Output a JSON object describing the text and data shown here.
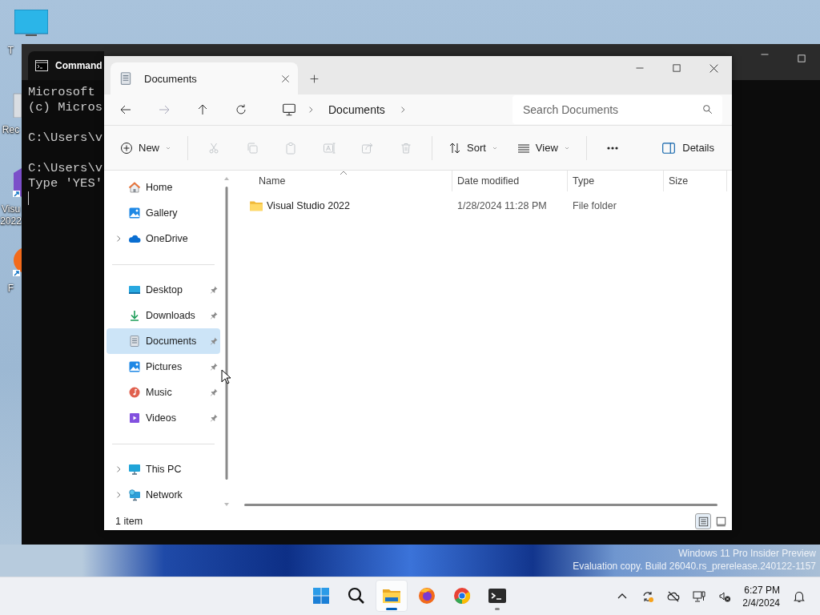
{
  "desktop": {
    "icons": [
      {
        "label_lines": [
          "T"
        ]
      },
      {
        "label_lines": [
          "Rec"
        ]
      },
      {
        "label_lines": [
          "Visu",
          "2022"
        ]
      },
      {
        "label_lines": [
          "F"
        ]
      }
    ],
    "watermark": [
      "Windows 11 Pro Insider Preview",
      "Evaluation copy. Build 26040.rs_prerelease.240122-1157"
    ]
  },
  "command_window": {
    "title": "Command",
    "blocks": [
      [
        "Microsoft",
        "(c) Micros"
      ],
      [
        "C:\\Users\\v"
      ],
      [
        "C:\\Users\\v",
        "Type 'YES'"
      ]
    ]
  },
  "explorer": {
    "tabs": [
      {
        "label": "Documents",
        "selected": true
      }
    ],
    "address": {
      "crumbs": [
        "Documents"
      ]
    },
    "search": {
      "placeholder": "Search Documents"
    },
    "commands": [
      {
        "kind": "menu",
        "label": "New",
        "disabled": false
      },
      {
        "kind": "separator"
      },
      {
        "kind": "icon",
        "disabled": true
      },
      {
        "kind": "icon",
        "disabled": true
      },
      {
        "kind": "icon",
        "disabled": true
      },
      {
        "kind": "icon",
        "disabled": true
      },
      {
        "kind": "icon",
        "disabled": true
      },
      {
        "kind": "icon",
        "disabled": true
      },
      {
        "kind": "separator"
      },
      {
        "kind": "menu",
        "label": "Sort",
        "disabled": false
      },
      {
        "kind": "menu",
        "label": "View",
        "disabled": false
      },
      {
        "kind": "separator"
      },
      {
        "kind": "icon",
        "disabled": false
      }
    ],
    "details_button": {
      "label": "Details"
    },
    "nav_groups": [
      [
        {
          "label": "Home",
          "expandable": false,
          "pinned": false,
          "selected": false
        },
        {
          "label": "Gallery",
          "expandable": false,
          "pinned": false,
          "selected": false
        },
        {
          "label": "OneDrive",
          "expandable": true,
          "pinned": false,
          "selected": false
        }
      ],
      [
        {
          "label": "Desktop",
          "expandable": false,
          "pinned": true,
          "selected": false
        },
        {
          "label": "Downloads",
          "expandable": false,
          "pinned": true,
          "selected": false
        },
        {
          "label": "Documents",
          "expandable": false,
          "pinned": true,
          "selected": true
        },
        {
          "label": "Pictures",
          "expandable": false,
          "pinned": true,
          "selected": false
        },
        {
          "label": "Music",
          "expandable": false,
          "pinned": true,
          "selected": false
        },
        {
          "label": "Videos",
          "expandable": false,
          "pinned": true,
          "selected": false
        }
      ],
      [
        {
          "label": "This PC",
          "expandable": true,
          "pinned": false,
          "selected": false
        },
        {
          "label": "Network",
          "expandable": true,
          "pinned": false,
          "selected": false
        }
      ]
    ],
    "columns": [
      {
        "label": "Name",
        "sorted": true
      },
      {
        "label": "Date modified",
        "sorted": false
      },
      {
        "label": "Type",
        "sorted": false
      },
      {
        "label": "Size",
        "sorted": false
      }
    ],
    "rows": [
      {
        "name": "Visual Studio 2022",
        "date_modified": "1/28/2024 11:28 PM",
        "type": "File folder",
        "selected": false
      }
    ],
    "status": "1 item",
    "views": [
      {
        "selected": true
      },
      {
        "selected": false
      }
    ]
  },
  "taskbar": {
    "apps": [
      {
        "active": false,
        "running": false
      },
      {
        "active": false,
        "running": false
      },
      {
        "active": true,
        "running": true
      },
      {
        "active": false,
        "running": false
      },
      {
        "active": false,
        "running": false
      },
      {
        "active": false,
        "running": true
      }
    ],
    "clock": {
      "time": "6:27 PM",
      "date": "2/4/2024"
    }
  }
}
